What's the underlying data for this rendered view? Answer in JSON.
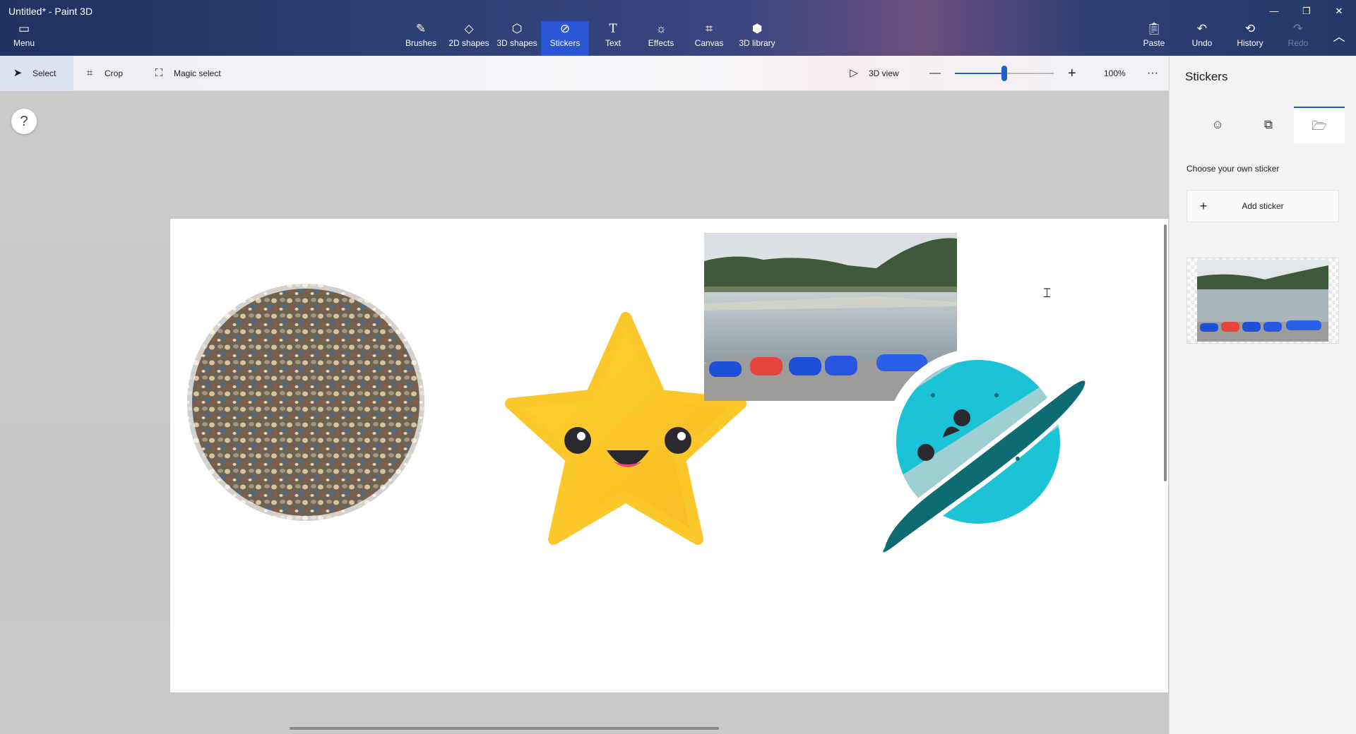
{
  "window": {
    "title": "Untitled* - Paint 3D",
    "minimize_glyph": "—",
    "restore_glyph": "❐",
    "close_glyph": "✕"
  },
  "toolbar": {
    "menu": {
      "label": "Menu",
      "icon": "folder-icon"
    },
    "tools": [
      {
        "label": "Brushes",
        "icon": "brush-icon"
      },
      {
        "label": "2D shapes",
        "icon": "2d-shapes-icon"
      },
      {
        "label": "3D shapes",
        "icon": "cube-icon"
      },
      {
        "label": "Stickers",
        "icon": "sticker-icon",
        "active": true
      },
      {
        "label": "Text",
        "icon": "text-icon"
      },
      {
        "label": "Effects",
        "icon": "sun-icon"
      },
      {
        "label": "Canvas",
        "icon": "canvas-icon"
      },
      {
        "label": "3D library",
        "icon": "library-icon"
      }
    ],
    "paste": {
      "label": "Paste",
      "icon": "clipboard-icon"
    },
    "undo": {
      "label": "Undo",
      "icon": "undo-icon"
    },
    "history": {
      "label": "History",
      "icon": "history-icon"
    },
    "redo": {
      "label": "Redo",
      "icon": "redo-icon",
      "disabled": true
    },
    "collapse": {
      "icon": "chevron-up-icon"
    }
  },
  "subtoolbar": {
    "select": "Select",
    "crop": "Crop",
    "magic_select": "Magic select",
    "view_3d": "3D view",
    "zoom_minus": "—",
    "zoom_plus": "+",
    "zoom_level": "100%",
    "zoom_fraction": 0.5,
    "more": "···"
  },
  "help": {
    "label": "?"
  },
  "panel": {
    "title": "Stickers",
    "tabs": [
      {
        "icon": "sticker-face-icon"
      },
      {
        "icon": "texture-icon"
      },
      {
        "icon": "folder-open-icon",
        "active": true
      }
    ],
    "choose_label": "Choose your own sticker",
    "add_button": "Add sticker",
    "add_plus": "+"
  },
  "colors": {
    "accent": "#2a55d4",
    "star": "#fcc72b",
    "planet": "#1cc3d6",
    "ring": "#0e6b72"
  }
}
